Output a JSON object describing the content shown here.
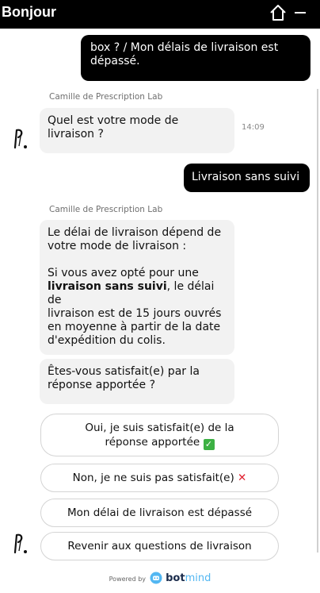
{
  "header": {
    "title": "Bonjour"
  },
  "messages": {
    "user_top_line1": "box ? / Mon délais de livraison est",
    "user_top_line2": "dépassé.",
    "sender1": "Camille de Prescription Lab",
    "bot_q1_line1": "Quel est votre mode de",
    "bot_q1_line2": "livraison ?",
    "time1": "14:09",
    "user_choice": "Livraison sans suivi",
    "sender2": "Camille de Prescription Lab",
    "bot_a_p1_line1": "Le délai de livraison dépend de",
    "bot_a_p1_line2": "votre mode de livraison :",
    "bot_a_p2_line1": "Si vous avez opté pour une",
    "bot_a_p2_bold": "livraison sans suivi",
    "bot_a_p2_line2_rest": ", le délai de",
    "bot_a_p2_line3": "livraison est de 15 jours ouvrés",
    "bot_a_p2_line4": "en moyenne à partir de la date",
    "bot_a_p2_line5": "d'expédition du colis.",
    "bot_sat_line1": "Êtes-vous satisfait(e) par la",
    "bot_sat_line2": "réponse apportée ?"
  },
  "options": {
    "yes_line1": "Oui, je suis satisfait(e) de la",
    "yes_line2": "réponse apportée",
    "no": "Non, je ne suis pas satisfait(e)",
    "late": "Mon délai de livraison est dépassé",
    "back": "Revenir aux questions de livraison"
  },
  "icons": {
    "home": "home-icon",
    "minimize": "minimize-icon",
    "avatar": "prescription-lab-logo",
    "check": "check-emoji",
    "cross": "cross-emoji"
  },
  "footer": {
    "powered_by": "Powered by",
    "brand_a": "bot",
    "brand_b": "mind"
  },
  "colors": {
    "header_bg": "#000000",
    "bot_bubble": "#f2f2f2",
    "user_bubble": "#000000",
    "brand_blue": "#53b7f2"
  }
}
